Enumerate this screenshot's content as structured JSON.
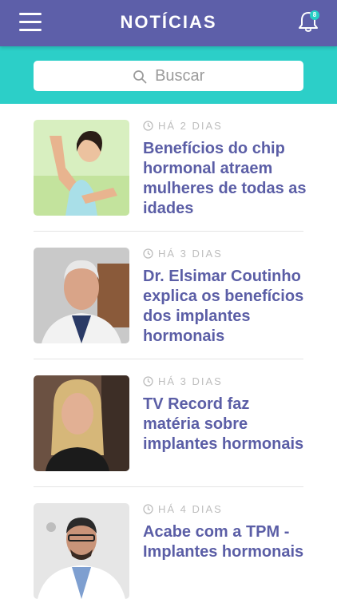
{
  "header": {
    "title": "NOTÍCIAS",
    "menu_icon": "hamburger-menu-icon",
    "bell_icon": "bell-icon",
    "notification_count": "8"
  },
  "search": {
    "placeholder": "Buscar",
    "icon": "search-icon"
  },
  "news": [
    {
      "time": "HÁ 2 DIAS",
      "title": "Benefícios do chip hormonal atraem mulheres de todas as idades"
    },
    {
      "time": "HÁ 3 DIAS",
      "title": "Dr. Elsimar Coutinho explica os benefícios dos implantes hormonais"
    },
    {
      "time": "HÁ 3 DIAS",
      "title": "TV Record faz matéria sobre implantes hormonais"
    },
    {
      "time": "HÁ 4 DIAS",
      "title": "Acabe com a TPM - Implantes hormonais"
    }
  ],
  "colors": {
    "header": "#5d5fa9",
    "search_bar": "#2ccfc8",
    "title_text": "#5b5ea6",
    "meta_text": "#bdbdbd"
  }
}
